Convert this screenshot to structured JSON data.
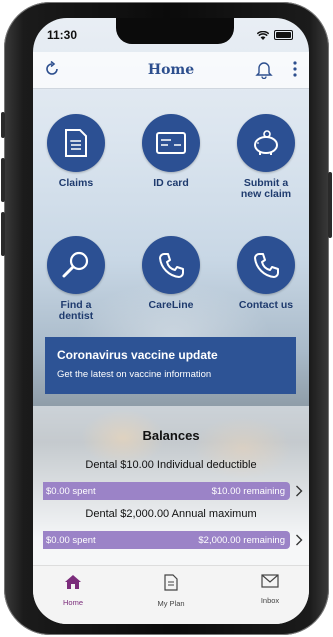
{
  "status": {
    "time": "11:30"
  },
  "header": {
    "title": "Home"
  },
  "tiles": [
    {
      "label": "Claims",
      "icon": "document-icon"
    },
    {
      "label": "ID card",
      "icon": "id-card-icon"
    },
    {
      "label": "Submit a\nnew claim",
      "icon": "piggy-bank-icon"
    },
    {
      "label": "Find a\ndentist",
      "icon": "magnifier-icon"
    },
    {
      "label": "CareLine",
      "icon": "phone-icon"
    },
    {
      "label": "Contact us",
      "icon": "phone-icon"
    }
  ],
  "banner": {
    "title": "Coronavirus vaccine update",
    "subtitle": "Get the latest on vaccine information"
  },
  "balances": {
    "title": "Balances",
    "items": [
      {
        "label": "Dental $10.00 Individual deductible",
        "spent": "$0.00 spent",
        "remaining": "$10.00 remaining"
      },
      {
        "label": "Dental $2,000.00 Annual maximum",
        "spent": "$0.00 spent",
        "remaining": "$2,000.00 remaining"
      }
    ]
  },
  "tabs": [
    {
      "label": "Home",
      "active": true,
      "icon": "house-icon"
    },
    {
      "label": "My Plan",
      "active": false,
      "icon": "document-icon"
    },
    {
      "label": "Inbox",
      "active": false,
      "icon": "envelope-icon"
    }
  ],
  "colors": {
    "primary": "#2c5093",
    "bar": "#9b83c7",
    "active_tab": "#7b2c7b"
  }
}
